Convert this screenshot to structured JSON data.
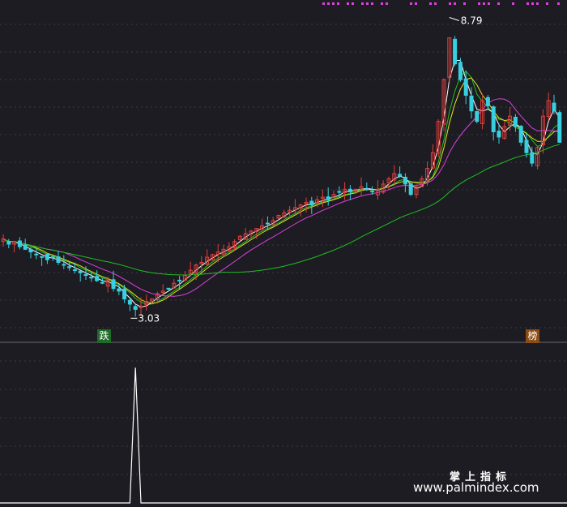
{
  "chart_data": [
    {
      "type": "candlestick",
      "annotations": {
        "high_label": "8.79",
        "low_label": "3.03"
      },
      "signals": {
        "down_badge": "跌",
        "up_badge": "榜"
      },
      "ma_colors": {
        "ma_short": "#ffffff",
        "ma_mid": "#e8e020",
        "ma_long": "#e040e0",
        "ma_longest": "#20c020"
      },
      "colors": {
        "up": "#e0403c",
        "down": "#38d0e0",
        "background": "#1c1c22",
        "grid": "#3a3a44"
      },
      "price_range": [
        2.6,
        9.0
      ],
      "close_series": [
        4.55,
        4.45,
        4.5,
        4.4,
        4.35,
        4.3,
        4.25,
        4.2,
        4.15,
        4.2,
        4.1,
        4.05,
        4.0,
        3.95,
        3.9,
        3.85,
        3.8,
        3.75,
        3.7,
        3.75,
        3.6,
        3.55,
        3.4,
        3.3,
        3.2,
        3.25,
        3.35,
        3.4,
        3.5,
        3.55,
        3.6,
        3.7,
        3.75,
        3.85,
        3.95,
        4.05,
        4.1,
        4.2,
        4.25,
        4.3,
        4.35,
        4.4,
        4.5,
        4.6,
        4.65,
        4.7,
        4.75,
        4.8,
        4.85,
        4.9,
        5.0,
        5.05,
        5.1,
        5.15,
        5.2,
        5.25,
        5.2,
        5.3,
        5.35,
        5.3,
        5.4,
        5.45,
        5.5,
        5.45,
        5.5,
        5.55,
        5.5,
        5.45,
        5.5,
        5.6,
        5.7,
        5.8,
        5.75,
        5.6,
        5.4,
        5.55,
        5.7,
        5.9,
        6.2,
        6.8,
        7.6,
        8.4,
        7.9,
        7.6,
        7.3,
        7.0,
        6.8,
        7.2,
        7.1,
        6.6,
        6.5,
        6.7,
        6.9,
        6.7,
        6.4,
        6.2,
        6.0,
        6.3,
        6.9,
        7.2,
        7.0,
        6.4
      ]
    },
    {
      "type": "line",
      "series": [
        {
          "values": [
            0,
            0,
            0,
            0,
            0,
            0,
            0,
            0,
            0,
            0,
            0,
            0,
            0,
            0,
            0,
            0,
            0,
            0,
            0,
            0,
            0,
            0,
            0,
            0,
            1.0,
            0,
            0,
            0,
            0,
            0,
            0,
            0,
            0,
            0,
            0,
            0,
            0,
            0,
            0,
            0,
            0,
            0,
            0,
            0,
            0,
            0,
            0,
            0,
            0,
            0,
            0,
            0,
            0,
            0,
            0,
            0,
            0,
            0,
            0,
            0,
            0,
            0,
            0,
            0,
            0,
            0,
            0,
            0,
            0,
            0,
            0,
            0,
            0,
            0,
            0,
            0,
            0,
            0,
            0,
            0,
            0,
            0,
            0,
            0,
            0,
            0,
            0,
            0,
            0,
            0,
            0,
            0,
            0,
            0,
            0,
            0,
            0,
            0,
            0,
            0,
            0,
            0
          ]
        }
      ],
      "ylim": [
        0,
        1.05
      ]
    }
  ],
  "watermark": {
    "cn": "掌上指标",
    "url": "www.palmindex.com"
  }
}
